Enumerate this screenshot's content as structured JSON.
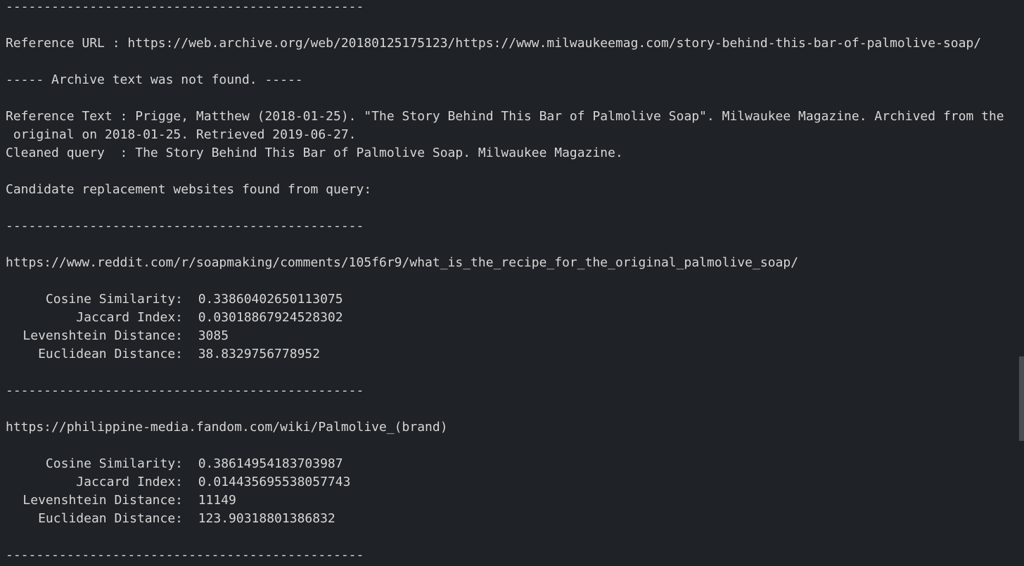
{
  "separator": "-----------------------------------------------",
  "reference": {
    "url_label": "Reference URL : https://web.archive.org/web/20180125175123/https://www.milwaukeemag.com/story-behind-this-bar-of-palmolive-soap/",
    "archive_notice": "----- Archive text was not found. -----",
    "text_line1": "Reference Text : Prigge, Matthew (2018-01-25). \"The Story Behind This Bar of Palmolive Soap\". Milwaukee Magazine. Archived from the",
    "text_line2": " original on 2018-01-25. Retrieved 2019-06-27.",
    "cleaned_query": "Cleaned query  : The Story Behind This Bar of Palmolive Soap. Milwaukee Magazine."
  },
  "candidates_heading": "Candidate replacement websites found from query:",
  "metric_labels": {
    "cosine": "Cosine Similarity:",
    "jaccard": "Jaccard Index:",
    "levenshtein": "Levenshtein Distance:",
    "euclidean": "Euclidean Distance:"
  },
  "candidates": [
    {
      "url": "https://www.reddit.com/r/soapmaking/comments/105f6r9/what_is_the_recipe_for_the_original_palmolive_soap/",
      "cosine": "0.33860402650113075",
      "jaccard": "0.03018867924528302",
      "levenshtein": "3085",
      "euclidean": "38.8329756778952"
    },
    {
      "url": "https://philippine-media.fandom.com/wiki/Palmolive_(brand)",
      "cosine": "0.38614954183703987",
      "jaccard": "0.014435695538057743",
      "levenshtein": "11149",
      "euclidean": "123.90318801386832"
    }
  ]
}
